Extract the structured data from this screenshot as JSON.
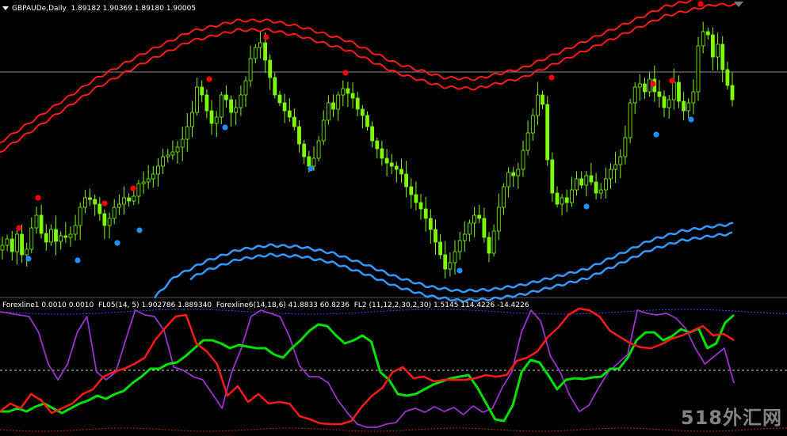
{
  "header": {
    "symbol": "GBPAUDe,Daily",
    "ohlc": "1.89182 1.90369 1.89180 1.90005"
  },
  "indicator_header": {
    "items": [
      "Forexline1 0.0010 0.0010",
      "FL05(14, 5) 1.902786 1.889340",
      "Forexline6(14,18,6) 41.8833 60.8236",
      "FL2 (11,12,2,30,2,30) 1.5145 114.4226 -14.4226"
    ]
  },
  "watermark": "518外汇网",
  "colors": {
    "background": "#000000",
    "candles": "#7CFC00",
    "upper_band": "#ff1a1a",
    "lower_band": "#3399ff",
    "dot_high": "#ff0000",
    "dot_low": "#1e90ff",
    "osc_green": "#00e000",
    "osc_red": "#ff1a1a",
    "osc_purple": "#9933cc",
    "level_line": "#cccccc",
    "upper_level": "#4444ff",
    "lower_level": "#cc2222"
  },
  "chart_data": [
    {
      "type": "line",
      "series": [
        {
          "values": [
            310,
            302,
            318,
            296,
            322,
            315,
            288,
            272,
            295,
            306,
            290,
            305,
            298,
            300,
            296,
            285,
            262,
            250,
            252,
            258,
            270,
            285,
            276,
            262,
            258,
            250,
            254,
            248,
            232,
            230,
            226,
            220,
            210,
            198,
            196,
            192,
            186,
            176,
            160,
            142,
            110,
            120,
            140,
            156,
            148,
            120,
            126,
            142,
            136,
            120,
            102,
            74,
            60,
            54,
            76,
            98,
            120,
            130,
            140,
            148,
            160,
            182,
            198,
            210,
            200,
            178,
            152,
            130,
            138,
            120,
            112,
            118,
            124,
            138,
            146,
            160,
            178,
            188,
            200,
            206,
            210,
            214,
            220,
            236,
            246,
            256,
            264,
            276,
            290,
            306,
            322,
            340,
            332,
            318,
            304,
            296,
            282,
            272,
            276,
            300,
            320,
            292,
            262,
            236,
            218,
            222,
            214,
            190,
            168,
            146,
            120,
            132,
            202,
            244,
            258,
            250,
            256,
            240,
            226,
            234,
            222,
            230,
            244,
            240,
            226,
            214,
            208,
            198,
            174,
            130,
            110,
            106,
            116,
            100,
            116,
            122,
            136,
            126,
            104,
            128,
            140,
            130,
            116,
            58,
            40,
            44,
            72,
            56,
            88,
            108,
            126
          ]
        }
      ]
    },
    {
      "type": "line",
      "series": [
        {
          "name": "FL05",
          "values": [
            520,
            520,
            516,
            520,
            514,
            510,
            516,
            522,
            516,
            510,
            506,
            500,
            504,
            498,
            494,
            484,
            476,
            466,
            466,
            460,
            458,
            450,
            440,
            430,
            430,
            434,
            440,
            436,
            438,
            440,
            440,
            448,
            452,
            440,
            430,
            418,
            410,
            412,
            424,
            434,
            430,
            424,
            432,
            470,
            480,
            498,
            500,
            498,
            492,
            486,
            482,
            478,
            476,
            474,
            490,
            510,
            530,
            532,
            512,
            470,
            455,
            458,
            474,
            492,
            480,
            478,
            479,
            477,
            476,
            466,
            466,
            452,
            430,
            420,
            420,
            430,
            425,
            416,
            420,
            415,
            440,
            434,
            408,
            398
          ]
        },
        {
          "name": "FL2",
          "values": [
            520,
            510,
            516,
            498,
            506,
            522,
            516,
            510,
            498,
            492,
            476,
            470,
            466,
            460,
            452,
            430,
            414,
            400,
            398,
            434,
            444,
            460,
            500,
            488,
            508,
            498,
            510,
            508,
            510,
            526,
            530,
            535,
            536,
            536,
            532,
            514,
            500,
            490,
            470,
            464,
            478,
            476,
            482,
            480,
            480,
            480,
            478,
            474,
            476,
            474,
            456,
            452,
            444,
            426,
            414,
            398,
            390,
            392,
            400,
            418,
            426,
            434,
            439,
            440,
            435,
            428,
            424,
            418,
            412,
            424,
            422,
            430
          ]
        },
        {
          "name": "Forexline6",
          "values": [
            394,
            396,
            398,
            400,
            420,
            460,
            480,
            460,
            420,
            400,
            470,
            480,
            470,
            430,
            392,
            398,
            400,
            418,
            464,
            468,
            476,
            480,
            498,
            516,
            470,
            440,
            400,
            392,
            396,
            400,
            426,
            462,
            476,
            476,
            484,
            506,
            522,
            536,
            540,
            540,
            536,
            534,
            520,
            516,
            521,
            514,
            520,
            515,
            524,
            513,
            521,
            516,
            490,
            470,
            420,
            392,
            406,
            450,
            470,
            500,
            520,
            512,
            490,
            470,
            459,
            448,
            392,
            396,
            398,
            396,
            402,
            415,
            440,
            460,
            450,
            440,
            484
          ]
        }
      ]
    }
  ]
}
